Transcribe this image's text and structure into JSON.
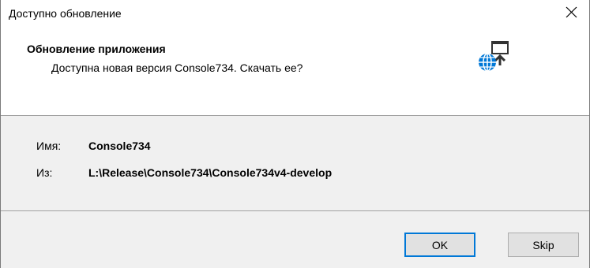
{
  "window": {
    "title": "Доступно обновление",
    "close_icon": "close-icon"
  },
  "header": {
    "title": "Обновление приложения",
    "subtitle": "Доступна новая версия Console734. Скачать ее?",
    "icon": "globe-update-icon",
    "icon_color": "#0078d7"
  },
  "details": {
    "name_label": "Имя:",
    "name_value": "Console734",
    "from_label": "Из:",
    "from_value": "L:\\Release\\Console734\\Console734v4-develop"
  },
  "buttons": {
    "ok_label": "OK",
    "skip_label": "Skip"
  }
}
